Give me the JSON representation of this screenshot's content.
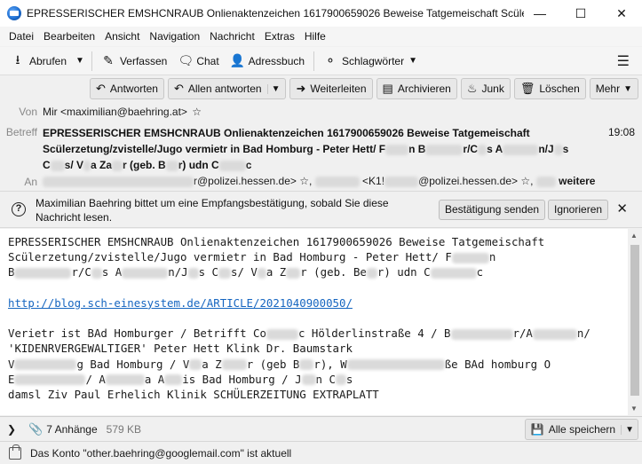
{
  "window": {
    "title": "EPRESSERISCHER EMSHCNRAUB Onlienaktenzeichen 1617900659026 Beweise Tatgemeischaft Scülerzet..."
  },
  "menu": [
    "Datei",
    "Bearbeiten",
    "Ansicht",
    "Navigation",
    "Nachricht",
    "Extras",
    "Hilfe"
  ],
  "toolbar": {
    "abrufen": "Abrufen",
    "verfassen": "Verfassen",
    "chat": "Chat",
    "adressbuch": "Adressbuch",
    "schlagwoerter": "Schlagwörter"
  },
  "actions": {
    "antworten": "Antworten",
    "allen_antworten": "Allen antworten",
    "weiterleiten": "Weiterleiten",
    "archivieren": "Archivieren",
    "junk": "Junk",
    "loeschen": "Löschen",
    "mehr": "Mehr"
  },
  "header": {
    "from_label": "Von",
    "from_value": "Mir <maximilian@baehring.at>",
    "subject_label": "Betreff",
    "subject_line1": "EPRESSERISCHER EMSHCNRAUB Onlienaktenzeichen 1617900659026 Beweise Tatgemeischaft",
    "subject_line2_a": "Scülerzetung/zvistelle/Jugo vermietr in Bad Homburg - Peter Hett/ F",
    "subject_line2_b": "n B",
    "subject_line2_c": "r/C",
    "subject_line2_d": "s A",
    "subject_line2_e": "n/J",
    "subject_line2_f": "s",
    "subject_line3_a": "C",
    "subject_line3_b": "s/ V",
    "subject_line3_c": "a Za",
    "subject_line3_d": "r (geb. B",
    "subject_line3_e": "r) udn C",
    "subject_line3_f": "c",
    "time": "19:08",
    "to_label": "An",
    "to_a": "r@polizei.hessen.de>",
    "to_b": "<K1!",
    "to_c": "@polizei.hessen.de>",
    "to_more": "weitere"
  },
  "notice": {
    "text": "Maximilian Baehring bittet um eine Empfangsbestätigung, sobald Sie diese Nachricht lesen.",
    "send": "Bestätigung senden",
    "ignore": "Ignorieren"
  },
  "body": {
    "l1": "EPRESSERISCHER EMSHCNRAUB Onlienaktenzeichen 1617900659026 Beweise Tatgemeischaft",
    "l2": "Scülerzetung/zvistelle/Jugo vermietr in Bad Homburg - Peter Hett/ F",
    "l2b": "n",
    "l3a": "B",
    "l3b": "r/C",
    "l3c": "s A",
    "l3d": "n/J",
    "l3e": "s C",
    "l3f": "s/ V",
    "l3g": "a Z",
    "l3h": "r (geb. Be",
    "l3i": "r) udn C",
    "l3j": "c",
    "link": "http://blog.sch-einesystem.de/ARTICLE/2021040900050/",
    "l5a": "Verietr ist BAd Homburger / Betrifft Co",
    "l5b": "c Hölderlinstraße 4 / B",
    "l5c": "r/A",
    "l5d": "n/",
    "l6": "'KIDENRVERGEWALTIGER' Peter Hett Klink Dr. Baumstark",
    "l7a": "V",
    "l7b": "g Bad Homburg / V",
    "l7c": "a Z",
    "l7d": "r (geb B",
    "l7e": "r), W",
    "l7f": "ße BAd homburg O",
    "l8a": "E",
    "l8b": "/ A",
    "l8c": "a A",
    "l8d": "is Bad Homburg / J",
    "l8e": "n C",
    "l8f": "s",
    "l9": "damsl Ziv Paul Erhelich Klinik SCHÜLERZEITUNG EXTRAPLATT"
  },
  "attachments": {
    "count": "7 Anhänge",
    "size": "579 KB",
    "save_all": "Alle speichern"
  },
  "status": {
    "text": "Das Konto \"other.baehring@googlemail.com\" ist aktuell"
  }
}
